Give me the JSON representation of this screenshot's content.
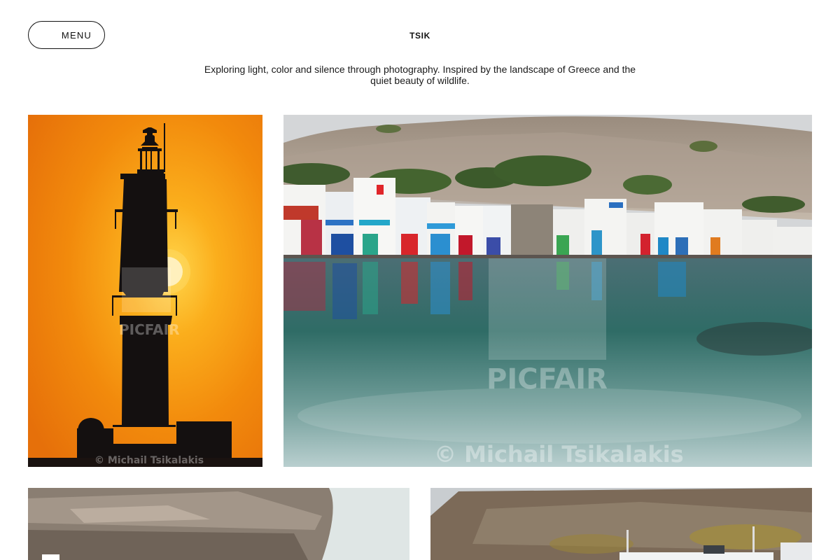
{
  "header": {
    "menu_label": "MENU",
    "site_title": "TSIK",
    "intro": "Exploring light, color and silence through photography. Inspired by the landscape of Greece and the quiet beauty of wildlife."
  },
  "gallery": {
    "watermark_brand": "PICFAIR",
    "copyright": "© Michail Tsikalakis",
    "photos": [
      {
        "subject": "lighthouse-sunset"
      },
      {
        "subject": "fishing-village-harbor"
      },
      {
        "subject": "sea-cliff"
      },
      {
        "subject": "hillside-village"
      }
    ]
  },
  "colors": {
    "background": "#ffffff",
    "text": "#111111",
    "sunset_orange": "#f4880a",
    "sea_teal": "#3e7f7c"
  }
}
